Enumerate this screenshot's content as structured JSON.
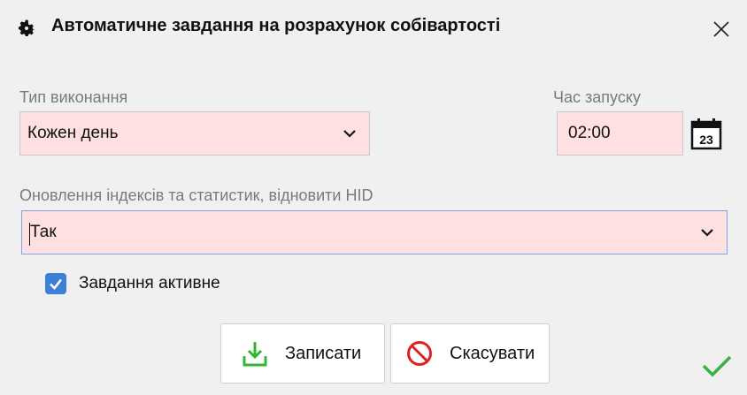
{
  "window": {
    "title": "Автоматичне завдання на розрахунок собівартості",
    "icon": "gear-icon",
    "close_icon": "close-icon"
  },
  "execution_type": {
    "label": "Тип виконання",
    "value": "Кожен день"
  },
  "start_time": {
    "label": "Час запуску",
    "value": "02:00",
    "calendar_icon_text": "23"
  },
  "index_update": {
    "label": "Оновлення індексів та статистик, відновити HID",
    "value": "Так"
  },
  "task_active": {
    "label": "Завдання активне",
    "checked": true
  },
  "buttons": {
    "save_label": "Записати",
    "cancel_label": "Скасувати"
  },
  "colors": {
    "required_field_bg": "#ffe0e0",
    "checkbox_accent": "#3b7fd6",
    "save_icon": "#2db82d",
    "cancel_icon": "#e02020",
    "ok_mark": "#3cb043"
  }
}
